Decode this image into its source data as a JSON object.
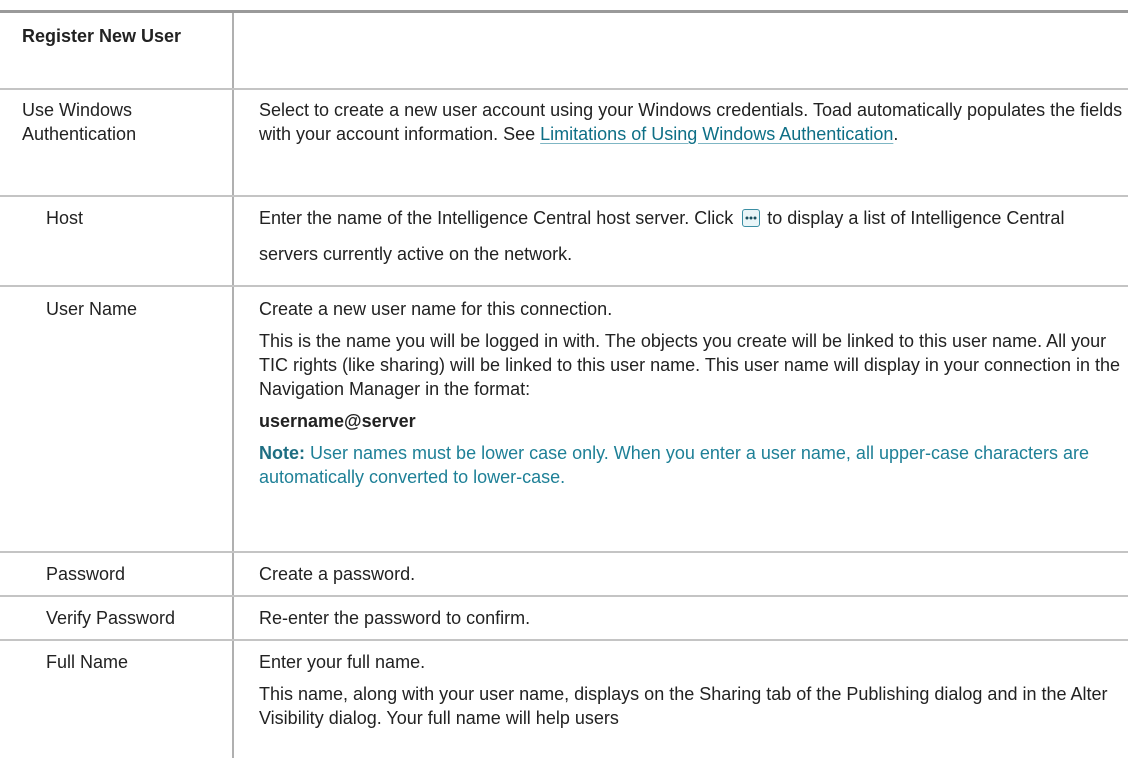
{
  "header": {
    "title": "Register New User"
  },
  "rows": [
    {
      "label": "Use Windows Authentication",
      "text_before_link": "Select to create a new user account using your Windows credentials. Toad automatically populates the fields with your account information. See ",
      "link_label": "Limitations of Using Windows Authentication",
      "text_after_link": "."
    },
    {
      "label": "Host",
      "text_before_icon": "Enter the name of the Intelligence Central host server. Click",
      "icon": "ellipsis-button-icon",
      "text_after_icon": "to display a list of Intelligence Central servers currently active on the network."
    },
    {
      "label": "User Name",
      "para1": "Create a new user name for this connection.",
      "para2": "This is the name you will be logged in with. The objects you create will be linked to this user name. All your TIC rights (like sharing) will be linked to this user name. This user name will display in your connection in the Navigation Manager in the format:",
      "format": "username@server",
      "note_label": "Note:",
      "note_text": "User names must be lower case only. When you enter a user name, all upper-case characters are automatically converted to lower-case."
    },
    {
      "label": "Password",
      "text": "Create a password."
    },
    {
      "label": "Verify Password",
      "text": "Re-enter the password to confirm."
    },
    {
      "label": "Full Name",
      "para1": "Enter your full name.",
      "para2": "This name, along with your user name, displays on the Sharing tab of the Publishing dialog and in the Alter Visibility dialog. Your full name will help users"
    }
  ],
  "colors": {
    "link": "#0e6f86",
    "note": "#1e8097",
    "rule": "#9a9a9a"
  }
}
